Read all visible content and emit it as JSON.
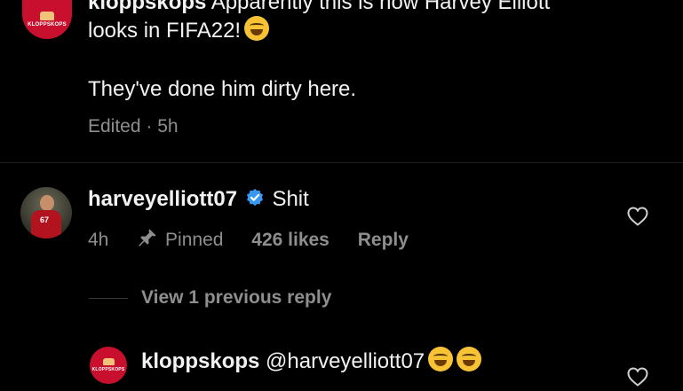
{
  "comment1": {
    "username": "kloppskops",
    "avatar_text": "KLOPPSKOPS",
    "line1": "Apparently this is now Harvey Elliott",
    "line2": "looks in FIFA22!",
    "line3": "They've done him dirty here.",
    "meta": "Edited · 5h",
    "emoji": "rofl-emoji"
  },
  "comment2": {
    "username": "harveyelliott07",
    "verified": true,
    "text": "Shit",
    "avatar_number": "67",
    "time": "4h",
    "pinned_label": "Pinned",
    "likes": "426 likes",
    "reply_label": "Reply"
  },
  "thread": {
    "view_replies_label": "View 1 previous reply"
  },
  "reply1": {
    "username": "kloppskops",
    "avatar_text": "KLOPPSKOPS",
    "mention": "@harveyelliott07",
    "emojis": [
      "rofl-emoji",
      "rofl-emoji"
    ]
  },
  "colors": {
    "background": "#000000",
    "text": "#f2f2f2",
    "muted": "#8e8e8e",
    "verified": "#3897f0",
    "brand_red": "#c8102e"
  },
  "icons": [
    "heart-icon",
    "pin-icon",
    "verified-badge-icon"
  ]
}
